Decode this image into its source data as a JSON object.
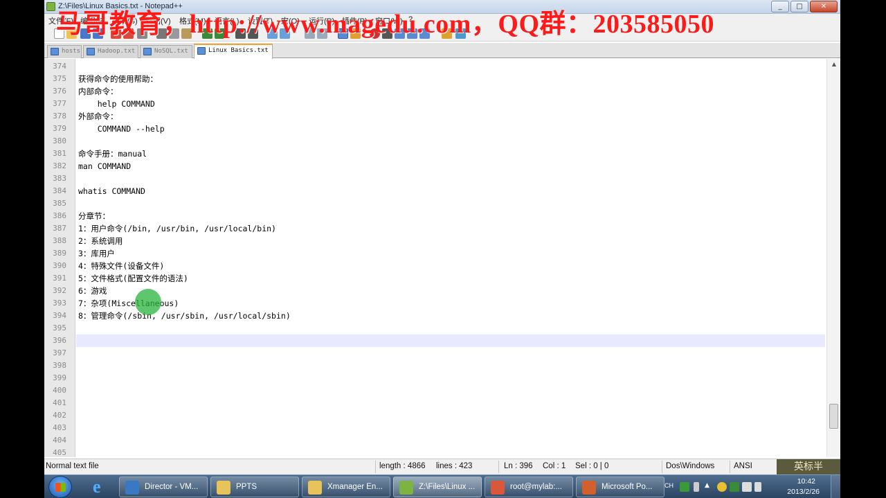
{
  "window": {
    "title": "Z:\\Files\\Linux Basics.txt - Notepad++",
    "buttons": [
      "_",
      "□",
      "✕"
    ]
  },
  "watermark": "马哥教育，http://www.magedu.com，QQ群：203585050",
  "menu": [
    "文件(F)",
    "编辑(E)",
    "搜索(S)",
    "视图(V)",
    "格式(M)",
    "语言(L)",
    "设置(T)",
    "宏(O)",
    "运行(R)",
    "插件(P)",
    "窗口(W)",
    "?"
  ],
  "tabs": [
    {
      "label": "hosts",
      "active": false
    },
    {
      "label": "Hadoop.txt",
      "active": false
    },
    {
      "label": "NoSQL.txt",
      "active": false
    },
    {
      "label": "Linux Basics.txt",
      "active": true
    }
  ],
  "editor": {
    "lines": [
      {
        "n": "374",
        "text": ""
      },
      {
        "n": "375",
        "text": "获得命令的使用帮助："
      },
      {
        "n": "376",
        "text": "内部命令："
      },
      {
        "n": "377",
        "text": "    help COMMAND"
      },
      {
        "n": "378",
        "text": "外部命令："
      },
      {
        "n": "379",
        "text": "    COMMAND --help"
      },
      {
        "n": "380",
        "text": ""
      },
      {
        "n": "381",
        "text": "命令手册：manual"
      },
      {
        "n": "382",
        "text": "man COMMAND"
      },
      {
        "n": "383",
        "text": ""
      },
      {
        "n": "384",
        "text": "whatis COMMAND"
      },
      {
        "n": "385",
        "text": ""
      },
      {
        "n": "386",
        "text": "分章节："
      },
      {
        "n": "387",
        "text": "1：用户命令(/bin, /usr/bin, /usr/local/bin)"
      },
      {
        "n": "388",
        "text": "2：系统调用"
      },
      {
        "n": "389",
        "text": "3：库用户"
      },
      {
        "n": "390",
        "text": "4：特殊文件(设备文件)"
      },
      {
        "n": "391",
        "text": "5：文件格式(配置文件的语法)"
      },
      {
        "n": "392",
        "text": "6：游戏"
      },
      {
        "n": "393",
        "text": "7：杂项(Miscellaneous)"
      },
      {
        "n": "394",
        "text": "8：管理命令(/sbin, /usr/sbin, /usr/local/sbin)"
      },
      {
        "n": "395",
        "text": ""
      },
      {
        "n": "396",
        "text": ""
      },
      {
        "n": "397",
        "text": ""
      },
      {
        "n": "398",
        "text": ""
      },
      {
        "n": "399",
        "text": ""
      },
      {
        "n": "400",
        "text": ""
      },
      {
        "n": "401",
        "text": ""
      },
      {
        "n": "402",
        "text": ""
      },
      {
        "n": "403",
        "text": ""
      },
      {
        "n": "404",
        "text": ""
      },
      {
        "n": "405",
        "text": ""
      }
    ],
    "current_line": "396",
    "scroll_position": 0.9
  },
  "status": {
    "file_type": "Normal text file",
    "length": "length : 4866",
    "lines": "lines : 423",
    "ln": "Ln : 396",
    "col": "Col : 1",
    "sel": "Sel : 0 | 0",
    "eol": "Dos\\Windows",
    "encoding": "ANSI",
    "corner": "英标半"
  },
  "taskbar": {
    "tasks": [
      {
        "label": "Director - VM...",
        "color": "#3a78c4"
      },
      {
        "label": "PPTS",
        "color": "#e8c35a"
      },
      {
        "label": "Xmanager En...",
        "color": "#e8c35a"
      },
      {
        "label": "Z:\\Files\\Linux ...",
        "color": "#7cb342"
      },
      {
        "label": "root@mylab:...",
        "color": "#d9583c"
      },
      {
        "label": "Microsoft Po...",
        "color": "#d2602c"
      }
    ],
    "lang": "CH",
    "time": "10:42",
    "date": "2013/2/26"
  }
}
